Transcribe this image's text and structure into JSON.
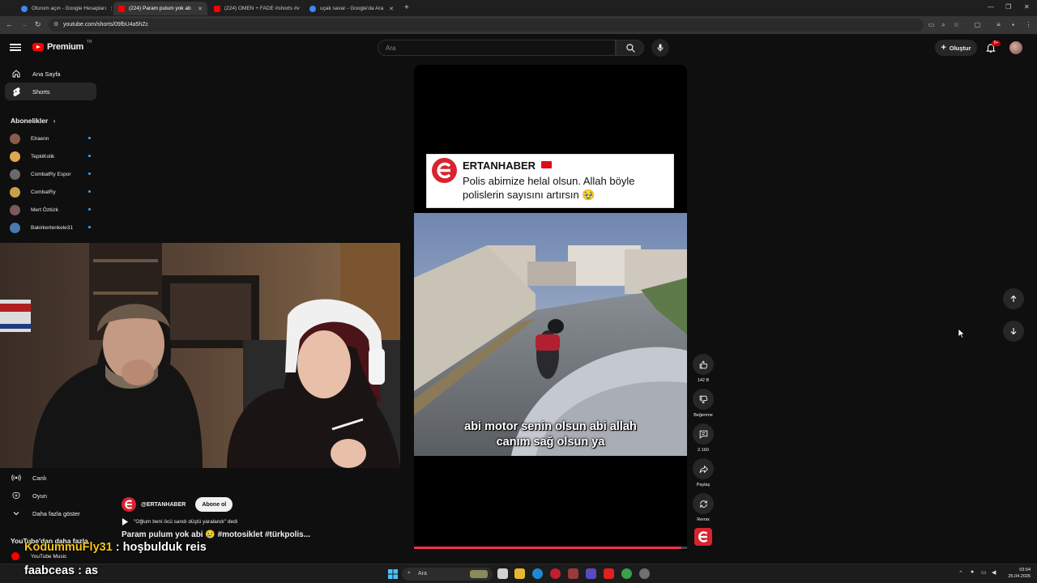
{
  "browser": {
    "tabs": [
      {
        "title": "Oturum açın - Google Hesapları",
        "active": false,
        "favicon_color": "#4285f4"
      },
      {
        "title": "(224) Param pulum yok ab",
        "active": true,
        "favicon_color": "#ff0000"
      },
      {
        "title": "(224) OMEN + FADE #shorts #v",
        "active": false,
        "favicon_color": "#ff0000"
      },
      {
        "title": "uçak savar - Google'da Ara",
        "active": false,
        "favicon_color": "#4285f4"
      }
    ],
    "new_tab": "+",
    "url": "youtube.com/shorts/09fbU4a5hZc"
  },
  "header": {
    "logo_text": "Premium",
    "logo_region": "TR",
    "search_placeholder": "Ara",
    "create_label": "Oluştur",
    "notification_count": "9+"
  },
  "sidebar": {
    "items": [
      {
        "label": "Ana Sayfa",
        "icon": "home-icon",
        "active": false
      },
      {
        "label": "Shorts",
        "icon": "shorts-icon",
        "active": true
      }
    ],
    "subscriptions_title": "Abonelikler",
    "subscriptions": [
      {
        "name": "Elraenn",
        "color": "#8a5a4a"
      },
      {
        "name": "TepkiKolik",
        "color": "#e0a84a"
      },
      {
        "name": "CombatRy Espor",
        "color": "#6a6a6a"
      },
      {
        "name": "CombatRy",
        "color": "#c9a04a"
      },
      {
        "name": "Mert Öztürk",
        "color": "#7a5a5a"
      },
      {
        "name": "Bakirkertenkele31",
        "color": "#4a7ab0"
      }
    ],
    "bottom_items": [
      {
        "label": "Canlı",
        "icon": "live-icon"
      },
      {
        "label": "Oyun",
        "icon": "gaming-icon"
      },
      {
        "label": "Daha fazla göster",
        "icon": "chevron-down-icon"
      }
    ],
    "more_from_title": "YouTube'dan daha fazla",
    "more_from_items": [
      {
        "label": "YouTube Music"
      }
    ]
  },
  "short": {
    "news_source": "ERTANHABER",
    "news_text": "Polis abimize helal olsun. Allah böyle polislerin sayısını artırsın 🥹",
    "caption_line1": "abi motor senin olsun abi allah",
    "caption_line2": "canım sağ olsun ya",
    "progress_fraction": 0.98,
    "channel": "@ERTANHABER",
    "subscribe_label": "Abone ol",
    "sound": "\"Oğlum beni öcü sandı düştü yaralandı\" dedi",
    "title": "Param pulum yok abi 😢 #motosiklet #türkpolis..."
  },
  "actions": [
    {
      "icon": "thumbs-up-icon",
      "label": "142 B"
    },
    {
      "icon": "thumbs-down-icon",
      "label": "Beğenme"
    },
    {
      "icon": "comment-icon",
      "label": "2.160"
    },
    {
      "icon": "share-icon",
      "label": "Paylaş"
    },
    {
      "icon": "remix-icon",
      "label": "Remix"
    }
  ],
  "chat": [
    {
      "user": "KodummuFly31",
      "message": ": hoşbulduk reis"
    },
    {
      "user": "faabceas",
      "message": ": as"
    }
  ],
  "taskbar": {
    "search_placeholder": "Ara",
    "time": "03:04",
    "date": "25.04.2026"
  }
}
